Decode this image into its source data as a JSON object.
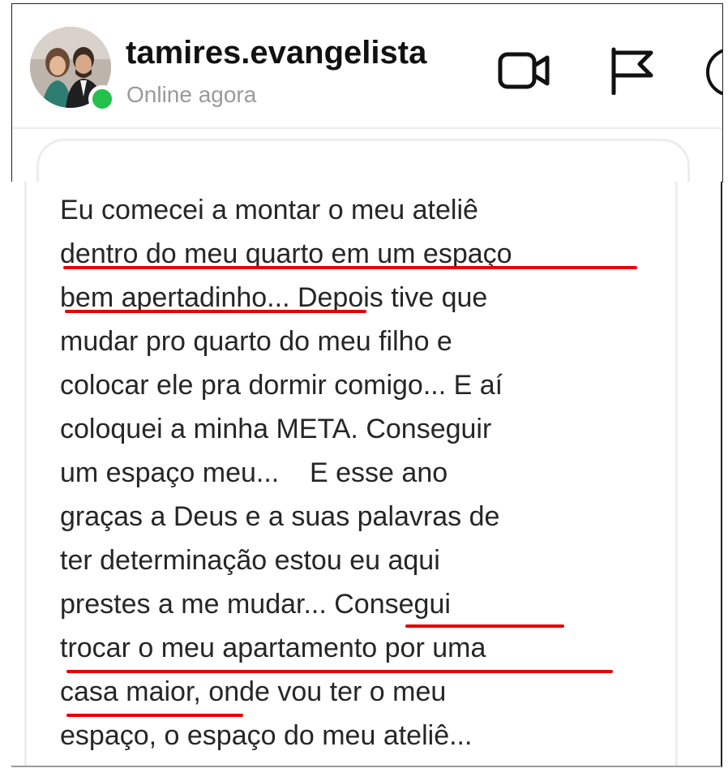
{
  "header": {
    "username": "tamires.evangelista",
    "status": "Online agora",
    "icons": {
      "video": "video-camera-icon",
      "flag": "flag-icon",
      "info": "info-icon"
    },
    "online_color": "#23c04b"
  },
  "message": {
    "lines": [
      "Eu comecei a montar o meu ateliê",
      "dentro do meu quarto em um espaço",
      "bem apertadinho... Depois tive que",
      "mudar pro quarto do meu filho e",
      "colocar ele pra dormir comigo... E aí",
      "coloquei a minha META. Conseguir",
      "um espaço meu...    E esse ano",
      "graças a Deus e a suas palavras de",
      "ter determinação estou eu aqui",
      "prestes a me mudar... Consegui",
      "trocar o meu apartamento por uma",
      "casa maior, onde vou ter o meu",
      "espaço, o espaço do meu ateliê..."
    ],
    "highlight_color": "#e60000"
  }
}
